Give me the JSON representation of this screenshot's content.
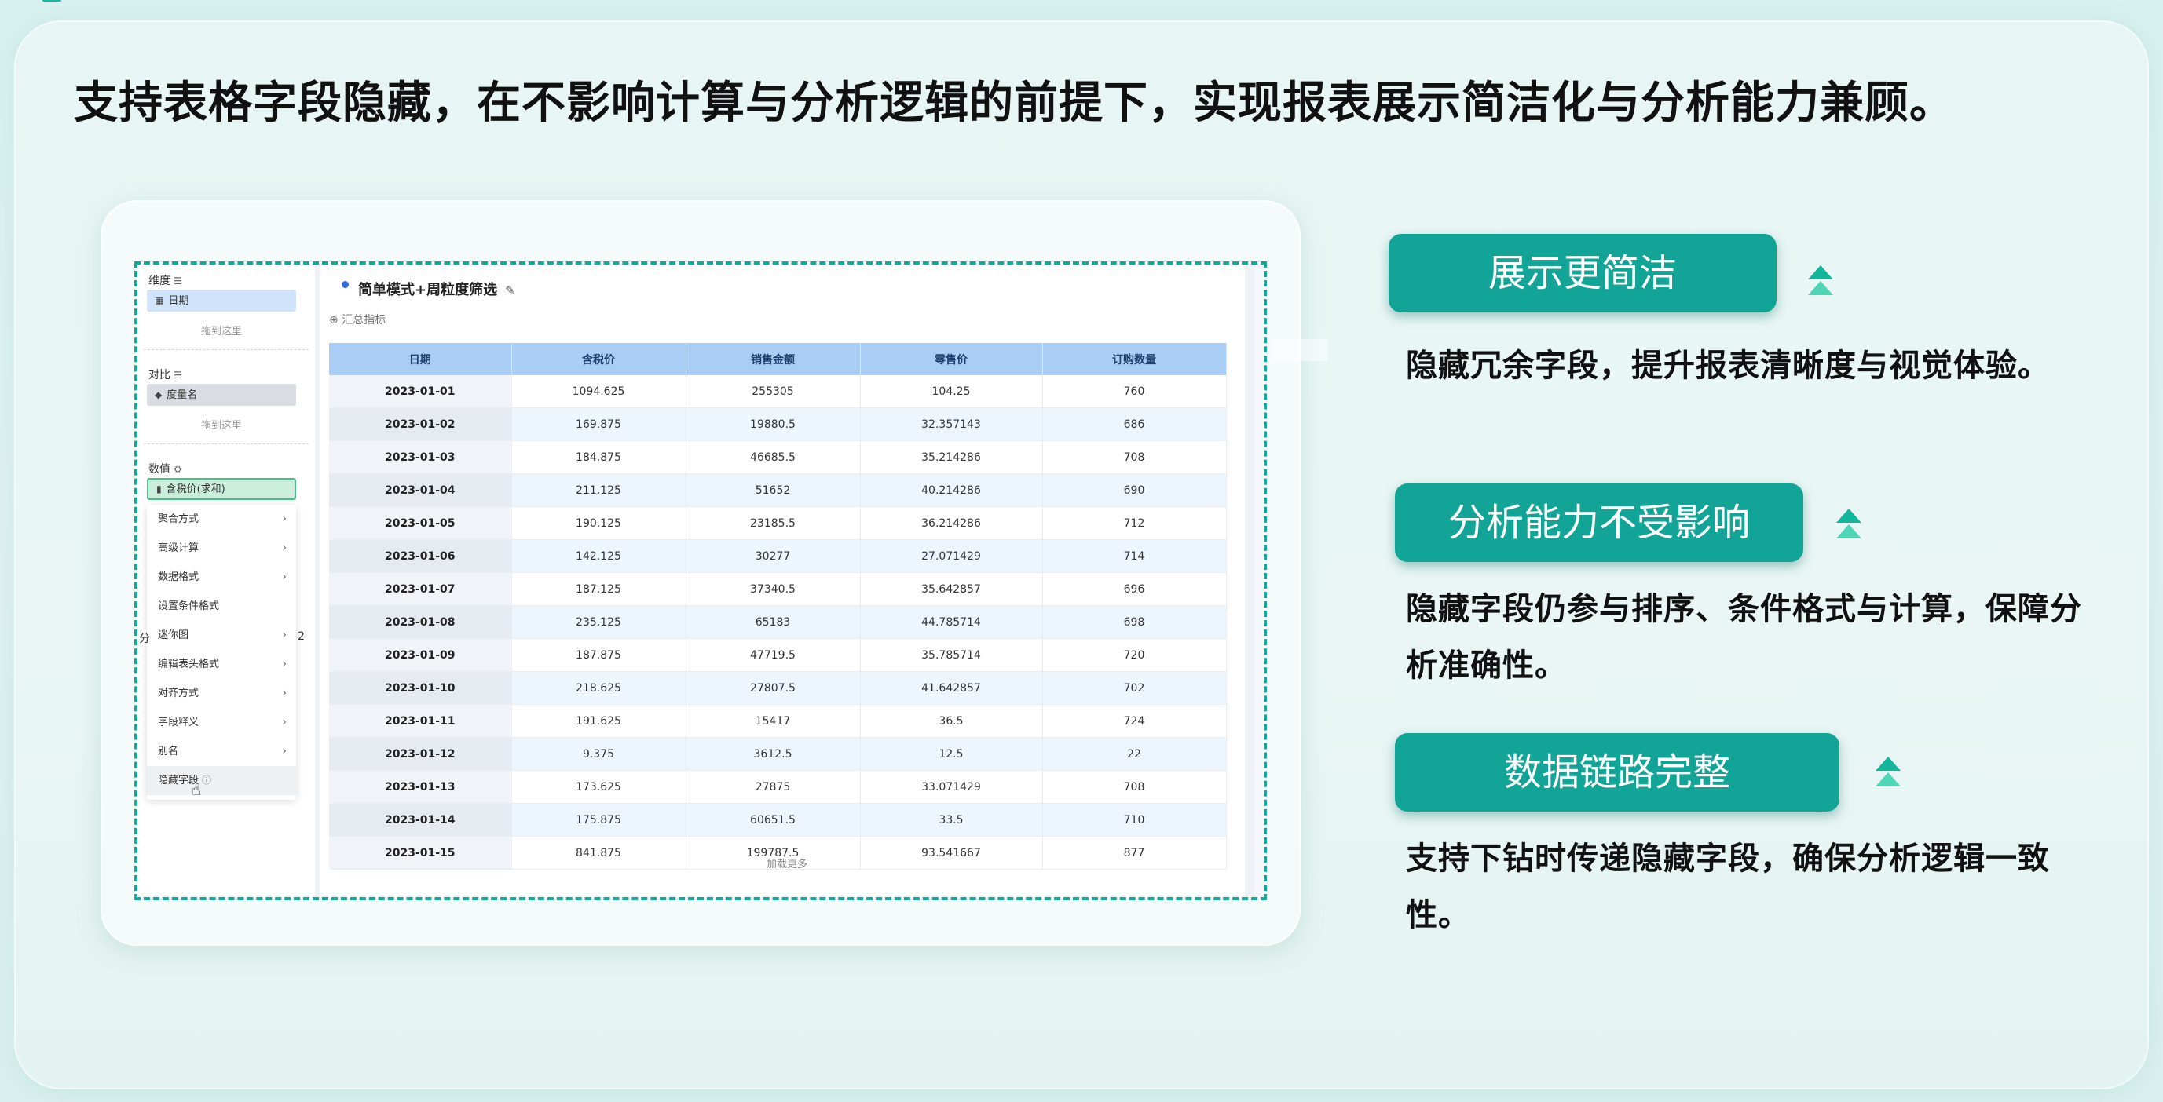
{
  "headline": "支持表格字段隐藏，在不影响计算与分析逻辑的前提下，实现报表展示简洁化与分析能力兼顾。",
  "left_panel": {
    "dimension_label": "维度",
    "dimension_field": "日期",
    "drop_here": "拖到这里",
    "compare_label": "对比",
    "compare_field": "度量名",
    "value_label": "数值",
    "value_field": "含税价(求和)",
    "menu_items": [
      {
        "label": "聚合方式",
        "arrow": "›"
      },
      {
        "label": "高级计算",
        "arrow": "›"
      },
      {
        "label": "数据格式",
        "arrow": "›"
      },
      {
        "label": "设置条件格式",
        "arrow": ""
      },
      {
        "label": "迷你图",
        "arrow": "›"
      },
      {
        "label": "编辑表头格式",
        "arrow": "›"
      },
      {
        "label": "对齐方式",
        "arrow": "›"
      },
      {
        "label": "字段释义",
        "arrow": "›"
      },
      {
        "label": "别名",
        "arrow": "›"
      },
      {
        "label": "隐藏字段",
        "arrow": ""
      }
    ],
    "stray_left": "分",
    "stray_right": "2"
  },
  "report": {
    "title": "简单模式+周粒度筛选",
    "summary_metric": "汇总指标",
    "columns": [
      "日期",
      "含税价",
      "销售金额",
      "零售价",
      "订购数量"
    ],
    "rows": [
      [
        "2023-01-01",
        "1094.625",
        "255305",
        "104.25",
        "760"
      ],
      [
        "2023-01-02",
        "169.875",
        "19880.5",
        "32.357143",
        "686"
      ],
      [
        "2023-01-03",
        "184.875",
        "46685.5",
        "35.214286",
        "708"
      ],
      [
        "2023-01-04",
        "211.125",
        "51652",
        "40.214286",
        "690"
      ],
      [
        "2023-01-05",
        "190.125",
        "23185.5",
        "36.214286",
        "712"
      ],
      [
        "2023-01-06",
        "142.125",
        "30277",
        "27.071429",
        "714"
      ],
      [
        "2023-01-07",
        "187.125",
        "37340.5",
        "35.642857",
        "696"
      ],
      [
        "2023-01-08",
        "235.125",
        "65183",
        "44.785714",
        "698"
      ],
      [
        "2023-01-09",
        "187.875",
        "47719.5",
        "35.785714",
        "720"
      ],
      [
        "2023-01-10",
        "218.625",
        "27807.5",
        "41.642857",
        "702"
      ],
      [
        "2023-01-11",
        "191.625",
        "15417",
        "36.5",
        "724"
      ],
      [
        "2023-01-12",
        "9.375",
        "3612.5",
        "12.5",
        "22"
      ],
      [
        "2023-01-13",
        "173.625",
        "27875",
        "33.071429",
        "708"
      ],
      [
        "2023-01-14",
        "175.875",
        "60651.5",
        "33.5",
        "710"
      ],
      [
        "2023-01-15",
        "841.875",
        "199787.5",
        "93.541667",
        "877"
      ]
    ],
    "load_more": "加载更多"
  },
  "features": [
    {
      "title": "展示更简洁",
      "desc": "隐藏冗余字段，提升报表清晰度与视觉体验。"
    },
    {
      "title": "分析能力不受影响",
      "desc": "隐藏字段仍参与排序、条件格式与计算，保障分析准确性。"
    },
    {
      "title": "数据链路完整",
      "desc": "支持下钻时传递隐藏字段，确保分析逻辑一致性。"
    }
  ],
  "colors": {
    "accent": "#11a497",
    "dash": "#14a89a",
    "table_header": "#a9cdf4"
  }
}
